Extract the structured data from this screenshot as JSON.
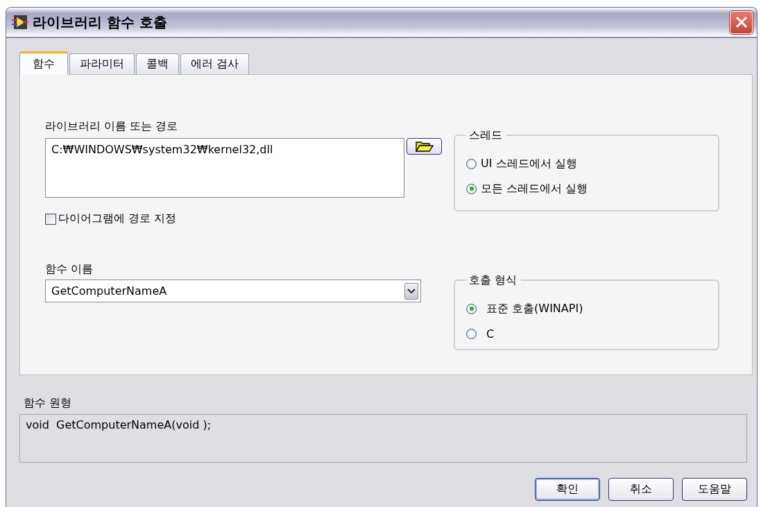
{
  "window": {
    "title": "라이브러리 함수 호출"
  },
  "tabs": [
    {
      "label": "함수",
      "selected": true
    },
    {
      "label": "파라미터",
      "selected": false
    },
    {
      "label": "콜백",
      "selected": false
    },
    {
      "label": "에러 검사",
      "selected": false
    }
  ],
  "library": {
    "label": "라이브러리 이름 또는 경로",
    "value": "C:₩WINDOWS₩system32₩kernel32,dll"
  },
  "path_checkbox": {
    "label": "다이어그램에 경로 지정",
    "checked": false
  },
  "function_name": {
    "label": "함수 이름",
    "value": "GetComputerNameA"
  },
  "thread": {
    "title": "스레드",
    "options": [
      {
        "label": "UI 스레드에서 실행",
        "selected": false
      },
      {
        "label": "모든 스레드에서 실행",
        "selected": true
      }
    ]
  },
  "calling_convention": {
    "title": "호출 형식",
    "options": [
      {
        "label": "표준 호출(WINAPI)",
        "selected": true
      },
      {
        "label": "C",
        "selected": false
      }
    ]
  },
  "prototype": {
    "label": "함수 원형",
    "value": "void  GetComputerNameA(void );"
  },
  "buttons": [
    "확인",
    "취소",
    "도움말"
  ]
}
